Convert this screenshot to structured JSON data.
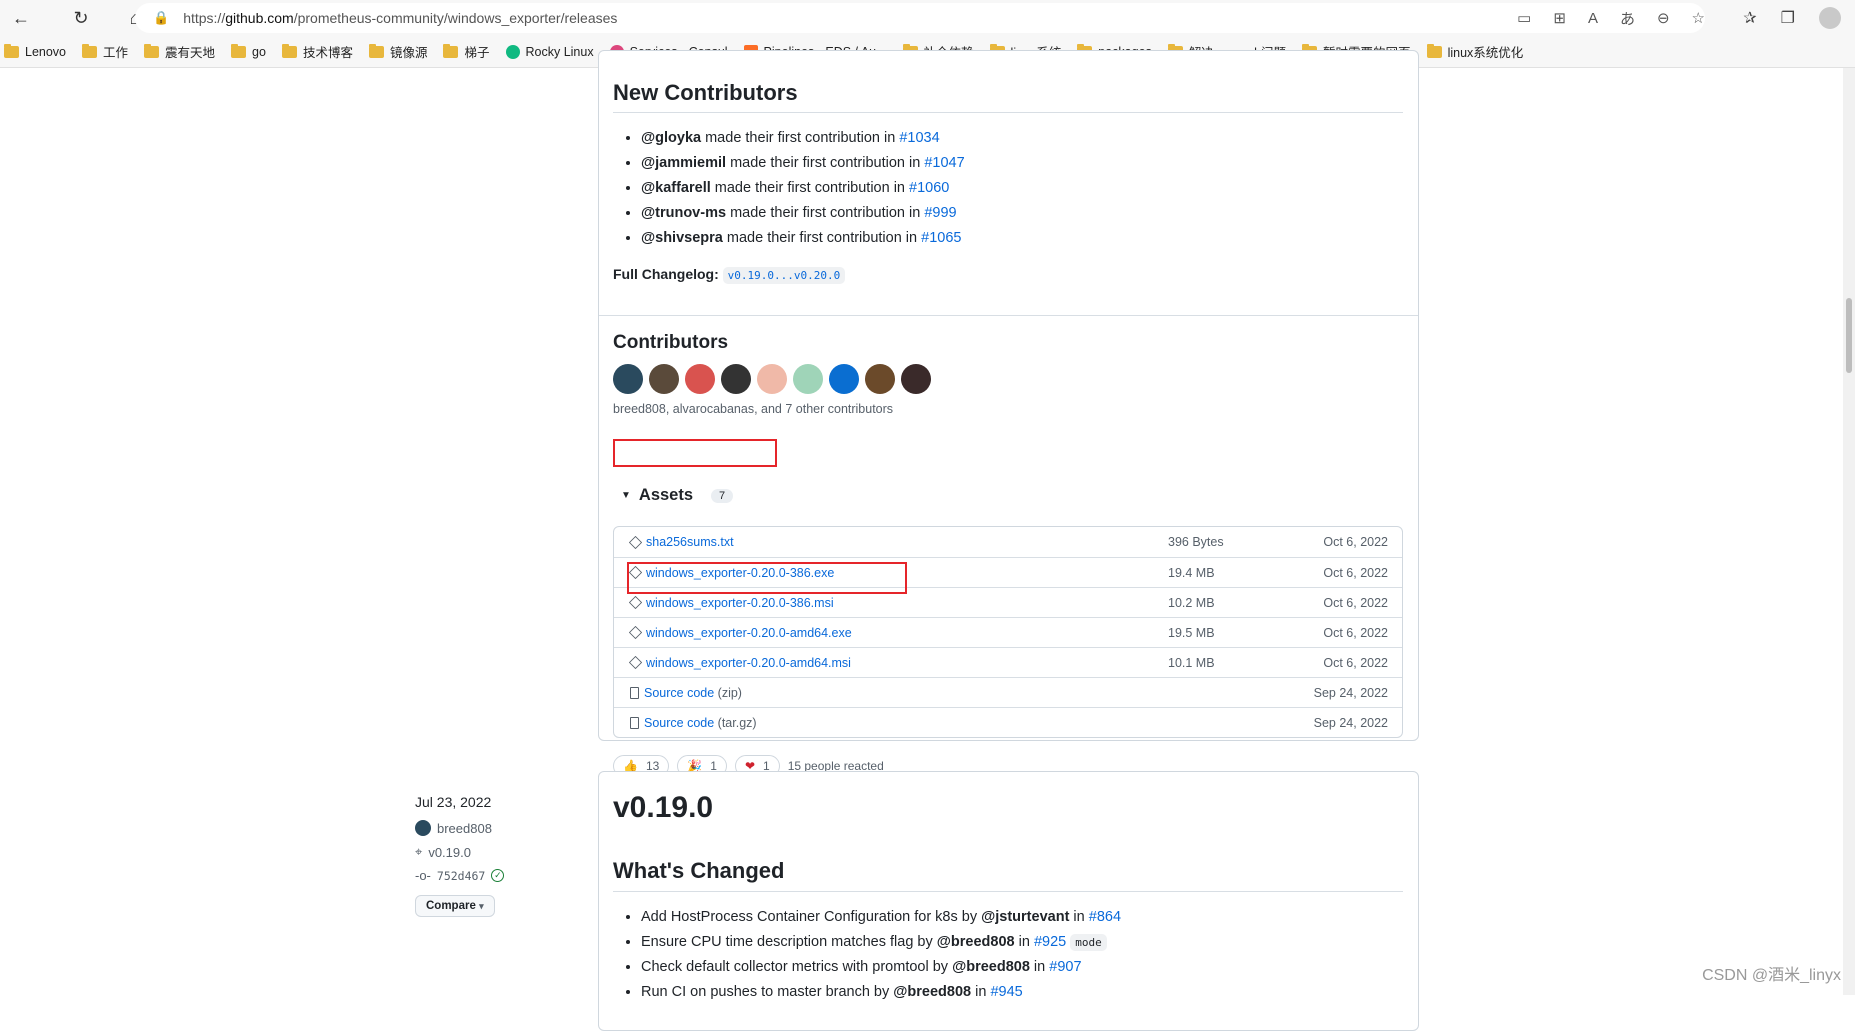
{
  "browser": {
    "url_prefix": "https://",
    "url_host": "github.com",
    "url_path": "/prometheus-community/windows_exporter/releases",
    "bookmarks": [
      "Lenovo",
      "工作",
      "震有天地",
      "go",
      "技术博客",
      "镜像源",
      "梯子",
      "Rocky Linux",
      "Services - Consul",
      "Pipelines · EDS / Au...",
      "补全依赖",
      "linux系统",
      "packages",
      "解决openssh问题",
      "暂时需要的网页",
      "linux系统优化"
    ]
  },
  "release1": {
    "new_contributors_title": "New Contributors",
    "new_contributors": [
      {
        "user": "@gloyka",
        "text": " made their first contribution in ",
        "pr": "#1034"
      },
      {
        "user": "@jammiemil",
        "text": " made their first contribution in ",
        "pr": "#1047"
      },
      {
        "user": "@kaffarell",
        "text": " made their first contribution in ",
        "pr": "#1060"
      },
      {
        "user": "@trunov-ms",
        "text": " made their first contribution in ",
        "pr": "#999"
      },
      {
        "user": "@shivsepra",
        "text": " made their first contribution in ",
        "pr": "#1065"
      }
    ],
    "full_changelog_label": "Full Changelog:",
    "full_changelog_link": "v0.19.0...v0.20.0",
    "contributors_title": "Contributors",
    "contributors_caption": "breed808, alvarocabanas, and 7 other contributors",
    "avatar_colors": [
      "#2a4a5e",
      "#5a4a3a",
      "#d9534f",
      "#333333",
      "#f0b9a8",
      "#9fd4b8",
      "#0a6ed1",
      "#6b4a2a",
      "#3a2a2a"
    ],
    "assets_label": "Assets",
    "assets_count": "7",
    "assets": [
      {
        "icon": "package-icon",
        "name": "sha256sums.txt",
        "suffix": "",
        "size": "396 Bytes",
        "date": "Oct 6, 2022"
      },
      {
        "icon": "package-icon",
        "name": "windows_exporter-0.20.0-386.exe",
        "suffix": "",
        "size": "19.4 MB",
        "date": "Oct 6, 2022"
      },
      {
        "icon": "package-icon",
        "name": "windows_exporter-0.20.0-386.msi",
        "suffix": "",
        "size": "10.2 MB",
        "date": "Oct 6, 2022"
      },
      {
        "icon": "package-icon",
        "name": "windows_exporter-0.20.0-amd64.exe",
        "suffix": "",
        "size": "19.5 MB",
        "date": "Oct 6, 2022"
      },
      {
        "icon": "package-icon",
        "name": "windows_exporter-0.20.0-amd64.msi",
        "suffix": "",
        "size": "10.1 MB",
        "date": "Oct 6, 2022"
      },
      {
        "icon": "file-zip-icon",
        "name": "Source code",
        "suffix": " (zip)",
        "size": "",
        "date": "Sep 24, 2022"
      },
      {
        "icon": "file-zip-icon",
        "name": "Source code",
        "suffix": " (tar.gz)",
        "size": "",
        "date": "Sep 24, 2022"
      }
    ],
    "reactions": [
      {
        "emoji": "👍",
        "count": "13"
      },
      {
        "emoji": "🎉",
        "count": "1"
      },
      {
        "emoji": "❤",
        "count": "1"
      }
    ],
    "reacted_text": "15 people reacted"
  },
  "release2": {
    "date": "Jul 23, 2022",
    "author": "breed808",
    "tag": "v0.19.0",
    "commit": "752d467",
    "compare_label": "Compare",
    "title": "v0.19.0",
    "whats_changed_title": "What's Changed",
    "changes": [
      {
        "pre": "Add HostProcess Container Configuration for k8s by ",
        "user": "@jsturtevant",
        "mid": " in ",
        "pr": "#864",
        "code": ""
      },
      {
        "pre": "Ensure CPU time description matches flag by ",
        "user": "@breed808",
        "mid": " in ",
        "pr": "#925",
        "code": "mode"
      },
      {
        "pre": "Check default collector metrics with promtool by ",
        "user": "@breed808",
        "mid": " in ",
        "pr": "#907",
        "code": ""
      },
      {
        "pre": "Run CI on pushes to master branch by ",
        "user": "@breed808",
        "mid": " in ",
        "pr": "#945",
        "code": ""
      }
    ]
  },
  "watermark": "CSDN @酒米_linyx"
}
